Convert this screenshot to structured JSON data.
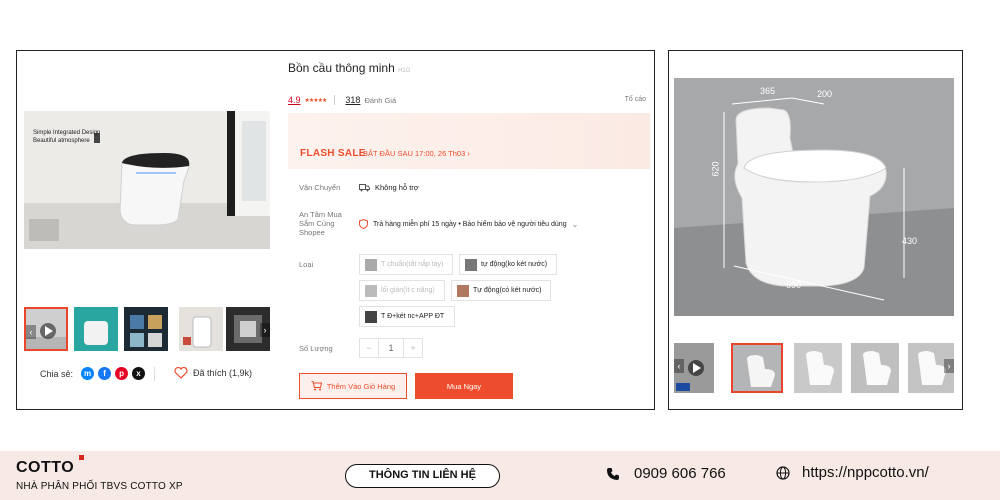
{
  "product": {
    "title": "Bồn cầu thông minh",
    "title_suffix": "H1G",
    "rating": "4.9",
    "stars": "★★★★★",
    "review_count": "318",
    "review_label": "Đánh Giá",
    "report_label": "Tố cáo",
    "image_caption_line1": "Simple Integrated Design",
    "image_caption_line2": "Beautiful atmosphere"
  },
  "flash_sale": {
    "label": "FLASH SALE",
    "time_text": "BẮT ĐẦU SAU 17:00, 26 Th03 ›"
  },
  "shipping": {
    "label": "Vận Chuyển",
    "value": "Không hỗ trợ"
  },
  "guarantee": {
    "label": "An Tâm Mua Sắm Cùng Shopee",
    "value": "Trả hàng miễn phí 15 ngày • Bảo hiểm bảo vệ người tiêu dùng"
  },
  "variants": {
    "label": "Loại",
    "options": [
      "T chuẩn(tắt nắp tay)",
      "tự động(ko két nước)",
      "lối giản(ít c năng)",
      "Tự động(có két nước)",
      "T Đ+két nc+APP ĐT"
    ]
  },
  "quantity": {
    "label": "Số Lượng",
    "minus": "−",
    "value": "1",
    "plus": "+"
  },
  "actions": {
    "add_to_cart": "Thêm Vào Giỏ Hàng",
    "buy_now": "Mua Ngay"
  },
  "share": {
    "label": "Chia sẻ:",
    "favorite": "Đã thích (1,9k)"
  },
  "dimensions": {
    "width_top": "365",
    "depth_top": "200",
    "height": "620",
    "seat_height": "430",
    "length": "690"
  },
  "footer": {
    "brand": "COTTO",
    "tagline": "NHÀ PHÂN PHỐI TBVS COTTO XP",
    "contact_button": "THÔNG TIN LIÊN HỆ",
    "phone": "0909 606 766",
    "website": "https://nppcotto.vn/"
  },
  "colors": {
    "accent": "#ee4d2d",
    "footer_bg": "#f7e9e5"
  }
}
